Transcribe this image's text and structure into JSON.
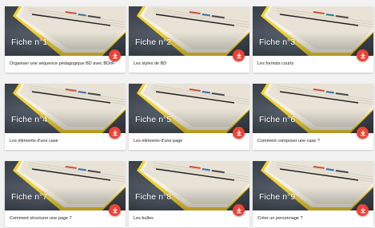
{
  "colors": {
    "accent": "#ea4335",
    "book_edge": "#f2d234",
    "background": "#f2f2f2"
  },
  "icons": {
    "download": "download-icon"
  },
  "cards": [
    {
      "title": "Fiche n°1",
      "caption": "Organiser une séquence pédagogique BD avec BDnF"
    },
    {
      "title": "Fiche n°2",
      "caption": "Les styles de BD"
    },
    {
      "title": "Fiche n°3",
      "caption": "Les formats courts"
    },
    {
      "title": "Fiche n°4",
      "caption": "Les éléments d'une case"
    },
    {
      "title": "Fiche n°5",
      "caption": "Les éléments d'une page"
    },
    {
      "title": "Fiche n°6",
      "caption": "Comment composer une case ?"
    },
    {
      "title": "Fiche n°7",
      "caption": "Comment structurer une page ?"
    },
    {
      "title": "Fiche n°8",
      "caption": "Les bulles"
    },
    {
      "title": "Fiche n°9",
      "caption": "Créer un personnage ?"
    }
  ]
}
